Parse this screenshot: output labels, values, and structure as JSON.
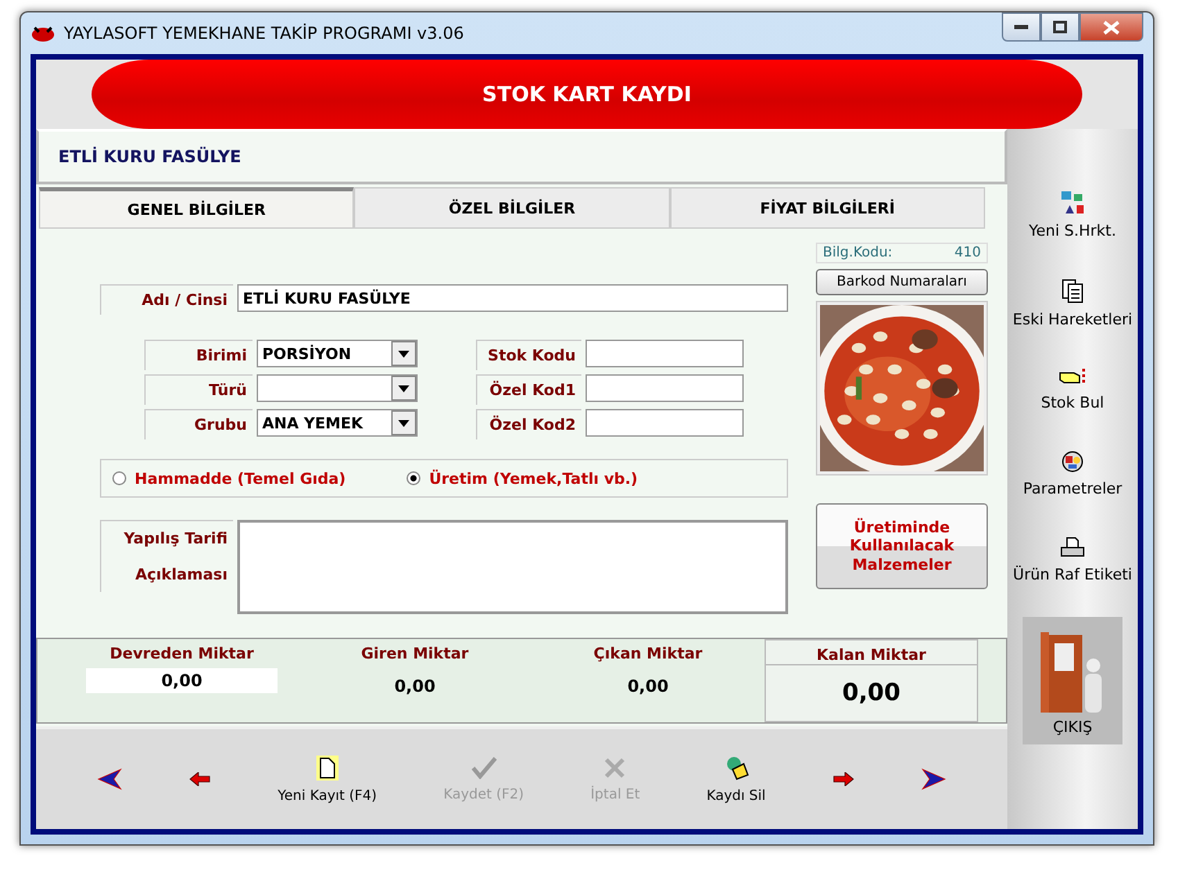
{
  "window": {
    "title": "YAYLASOFT YEMEKHANE TAKİP PROGRAMI v3.06"
  },
  "header": {
    "title": "STOK KART KAYDI"
  },
  "record_name": "ETLİ KURU FASÜLYE",
  "tabs": [
    {
      "label": "GENEL BİLGİLER",
      "selected": true
    },
    {
      "label": "ÖZEL BİLGİLER",
      "selected": false
    },
    {
      "label": "FİYAT BİLGİLERİ",
      "selected": false
    }
  ],
  "form": {
    "name": {
      "label": "Adı / Cinsi",
      "value": "ETLİ KURU FASÜLYE"
    },
    "left_fields": [
      {
        "label": "Birimi",
        "value": "PORSİYON"
      },
      {
        "label": "Türü"
      },
      {
        "label": "Grubu",
        "value": "ANA YEMEK"
      }
    ],
    "right_fields": [
      {
        "label": "Stok Kodu"
      },
      {
        "label": "Özel Kod1"
      },
      {
        "label": "Özel Kod2"
      }
    ],
    "type_options": [
      {
        "label": "Hammadde (Temel Gıda)",
        "selected": false
      },
      {
        "label": "Üretim (Yemek,Tatlı vb.)",
        "selected": true
      }
    ],
    "recipe": {
      "labels": [
        "Yapılış Tarifi",
        "Açıklaması"
      ]
    }
  },
  "side_panel": {
    "code_label": "Bilg.Kodu:",
    "code_value": "410",
    "barcode_button": "Barkod Numaraları",
    "materials_button": "Üretiminde Kullanılacak Malzemeler"
  },
  "totals": [
    {
      "label": "Devreden Miktar",
      "value": "0,00",
      "kind": "boxed"
    },
    {
      "label": "Giren Miktar",
      "value": "0,00",
      "kind": "plain"
    },
    {
      "label": "Çıkan Miktar",
      "value": "0,00",
      "kind": "plain"
    },
    {
      "label": "Kalan Miktar",
      "value": "0,00",
      "kind": "highlight"
    }
  ],
  "toolbar": [
    {
      "kind": "first"
    },
    {
      "kind": "prev"
    },
    {
      "kind": "new",
      "label": "Yeni Kayıt (F4)",
      "disabled": false
    },
    {
      "kind": "save",
      "label": "Kaydet (F2)",
      "disabled": true
    },
    {
      "kind": "cancel",
      "label": "İptal Et",
      "disabled": true
    },
    {
      "kind": "delete",
      "label": "Kaydı Sil",
      "disabled": false
    },
    {
      "kind": "next"
    },
    {
      "kind": "last"
    }
  ],
  "sidebar": {
    "items": [
      {
        "kind": "new-move",
        "label": "Yeni S.Hrkt."
      },
      {
        "kind": "history",
        "label": "Eski Hareketleri"
      },
      {
        "kind": "find",
        "label": "Stok Bul"
      },
      {
        "kind": "params",
        "label": "Parametreler"
      },
      {
        "kind": "label",
        "label": "Ürün Raf Etiketi"
      }
    ],
    "exit": "ÇIKIŞ"
  }
}
